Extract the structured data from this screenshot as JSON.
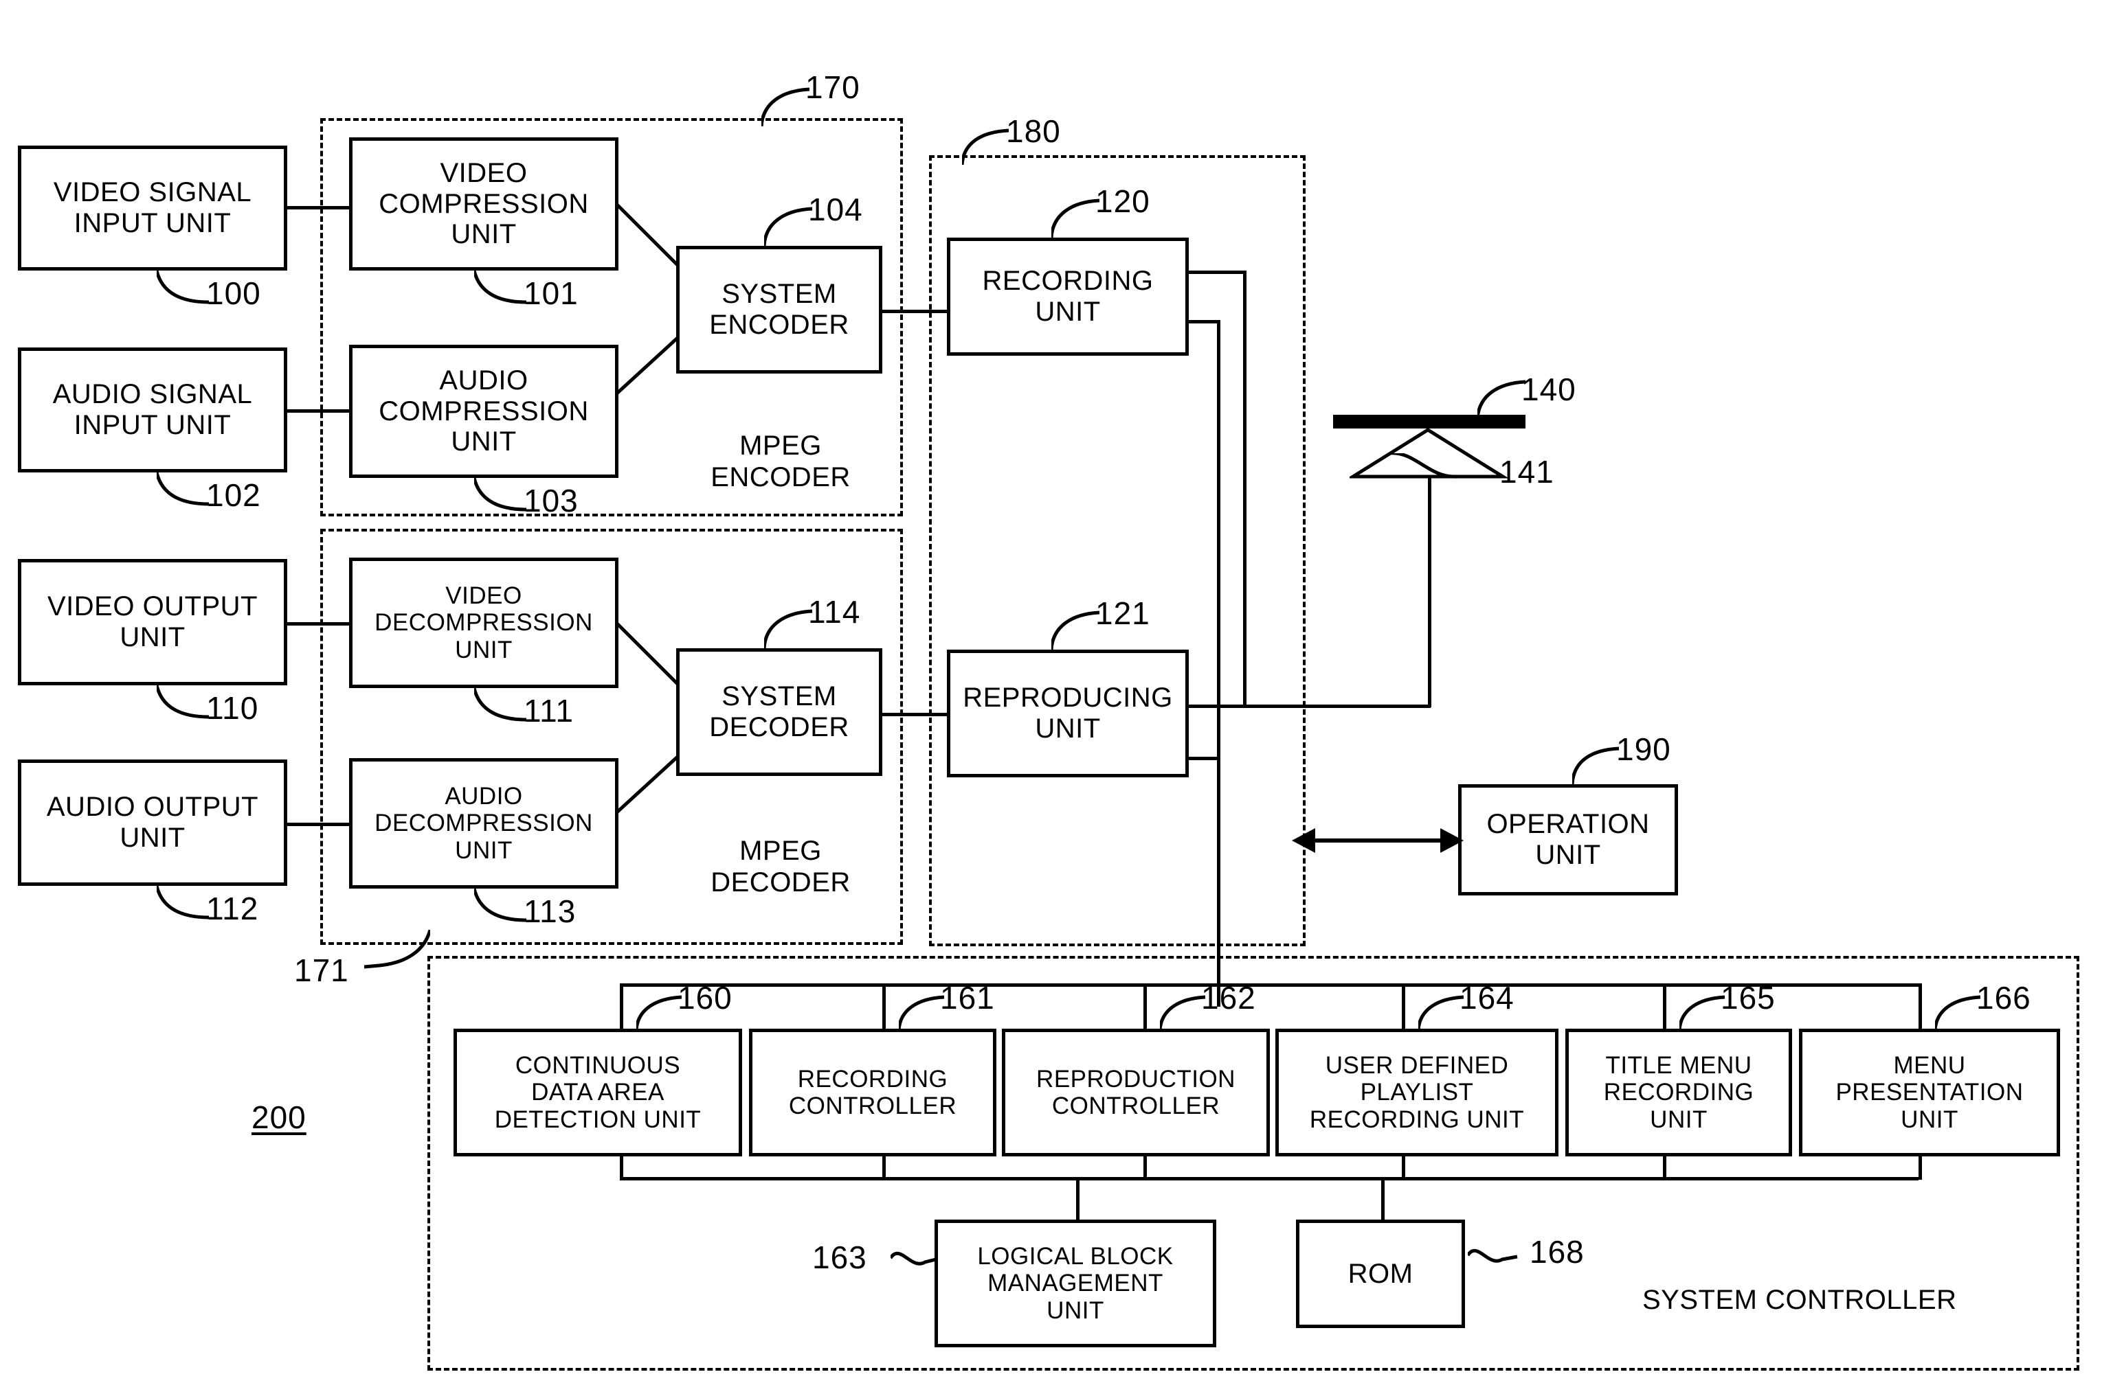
{
  "figure": {
    "blocks": {
      "video_signal_input": "VIDEO SIGNAL\nINPUT UNIT",
      "audio_signal_input": "AUDIO SIGNAL\nINPUT UNIT",
      "video_compression": "VIDEO\nCOMPRESSION\nUNIT",
      "audio_compression": "AUDIO\nCOMPRESSION\nUNIT",
      "system_encoder": "SYSTEM\nENCODER",
      "recording_unit": "RECORDING\nUNIT",
      "video_output": "VIDEO OUTPUT\nUNIT",
      "audio_output": "AUDIO OUTPUT\nUNIT",
      "video_decompression": "VIDEO\nDECOMPRESSION\nUNIT",
      "audio_decompression": "AUDIO\nDECOMPRESSION\nUNIT",
      "system_decoder": "SYSTEM\nDECODER",
      "reproducing_unit": "REPRODUCING\nUNIT",
      "operation_unit": "OPERATION\nUNIT",
      "continuous_data_area": "CONTINUOUS\nDATA AREA\nDETECTION UNIT",
      "recording_controller": "RECORDING\nCONTROLLER",
      "reproduction_controller": "REPRODUCTION\nCONTROLLER",
      "user_defined_playlist": "USER DEFINED\nPLAYLIST\nRECORDING UNIT",
      "title_menu_recording": "TITLE MENU\nRECORDING\nUNIT",
      "menu_presentation": "MENU\nPRESENTATION\nUNIT",
      "logical_block_management": "LOGICAL BLOCK\nMANAGEMENT\nUNIT",
      "rom": "ROM"
    },
    "captions": {
      "mpeg_encoder": "MPEG\nENCODER",
      "mpeg_decoder": "MPEG\nDECODER",
      "system_controller": "SYSTEM CONTROLLER"
    },
    "refs": {
      "r100": "100",
      "r101": "101",
      "r102": "102",
      "r103": "103",
      "r104": "104",
      "r110": "110",
      "r111": "111",
      "r112": "112",
      "r113": "113",
      "r114": "114",
      "r120": "120",
      "r121": "121",
      "r140": "140",
      "r141": "141",
      "r160": "160",
      "r161": "161",
      "r162": "162",
      "r163": "163",
      "r164": "164",
      "r165": "165",
      "r166": "166",
      "r168": "168",
      "r170": "170",
      "r171": "171",
      "r180": "180",
      "r190": "190",
      "r200": "200"
    },
    "colors": {
      "ink": "#000000",
      "paper": "#ffffff"
    }
  }
}
